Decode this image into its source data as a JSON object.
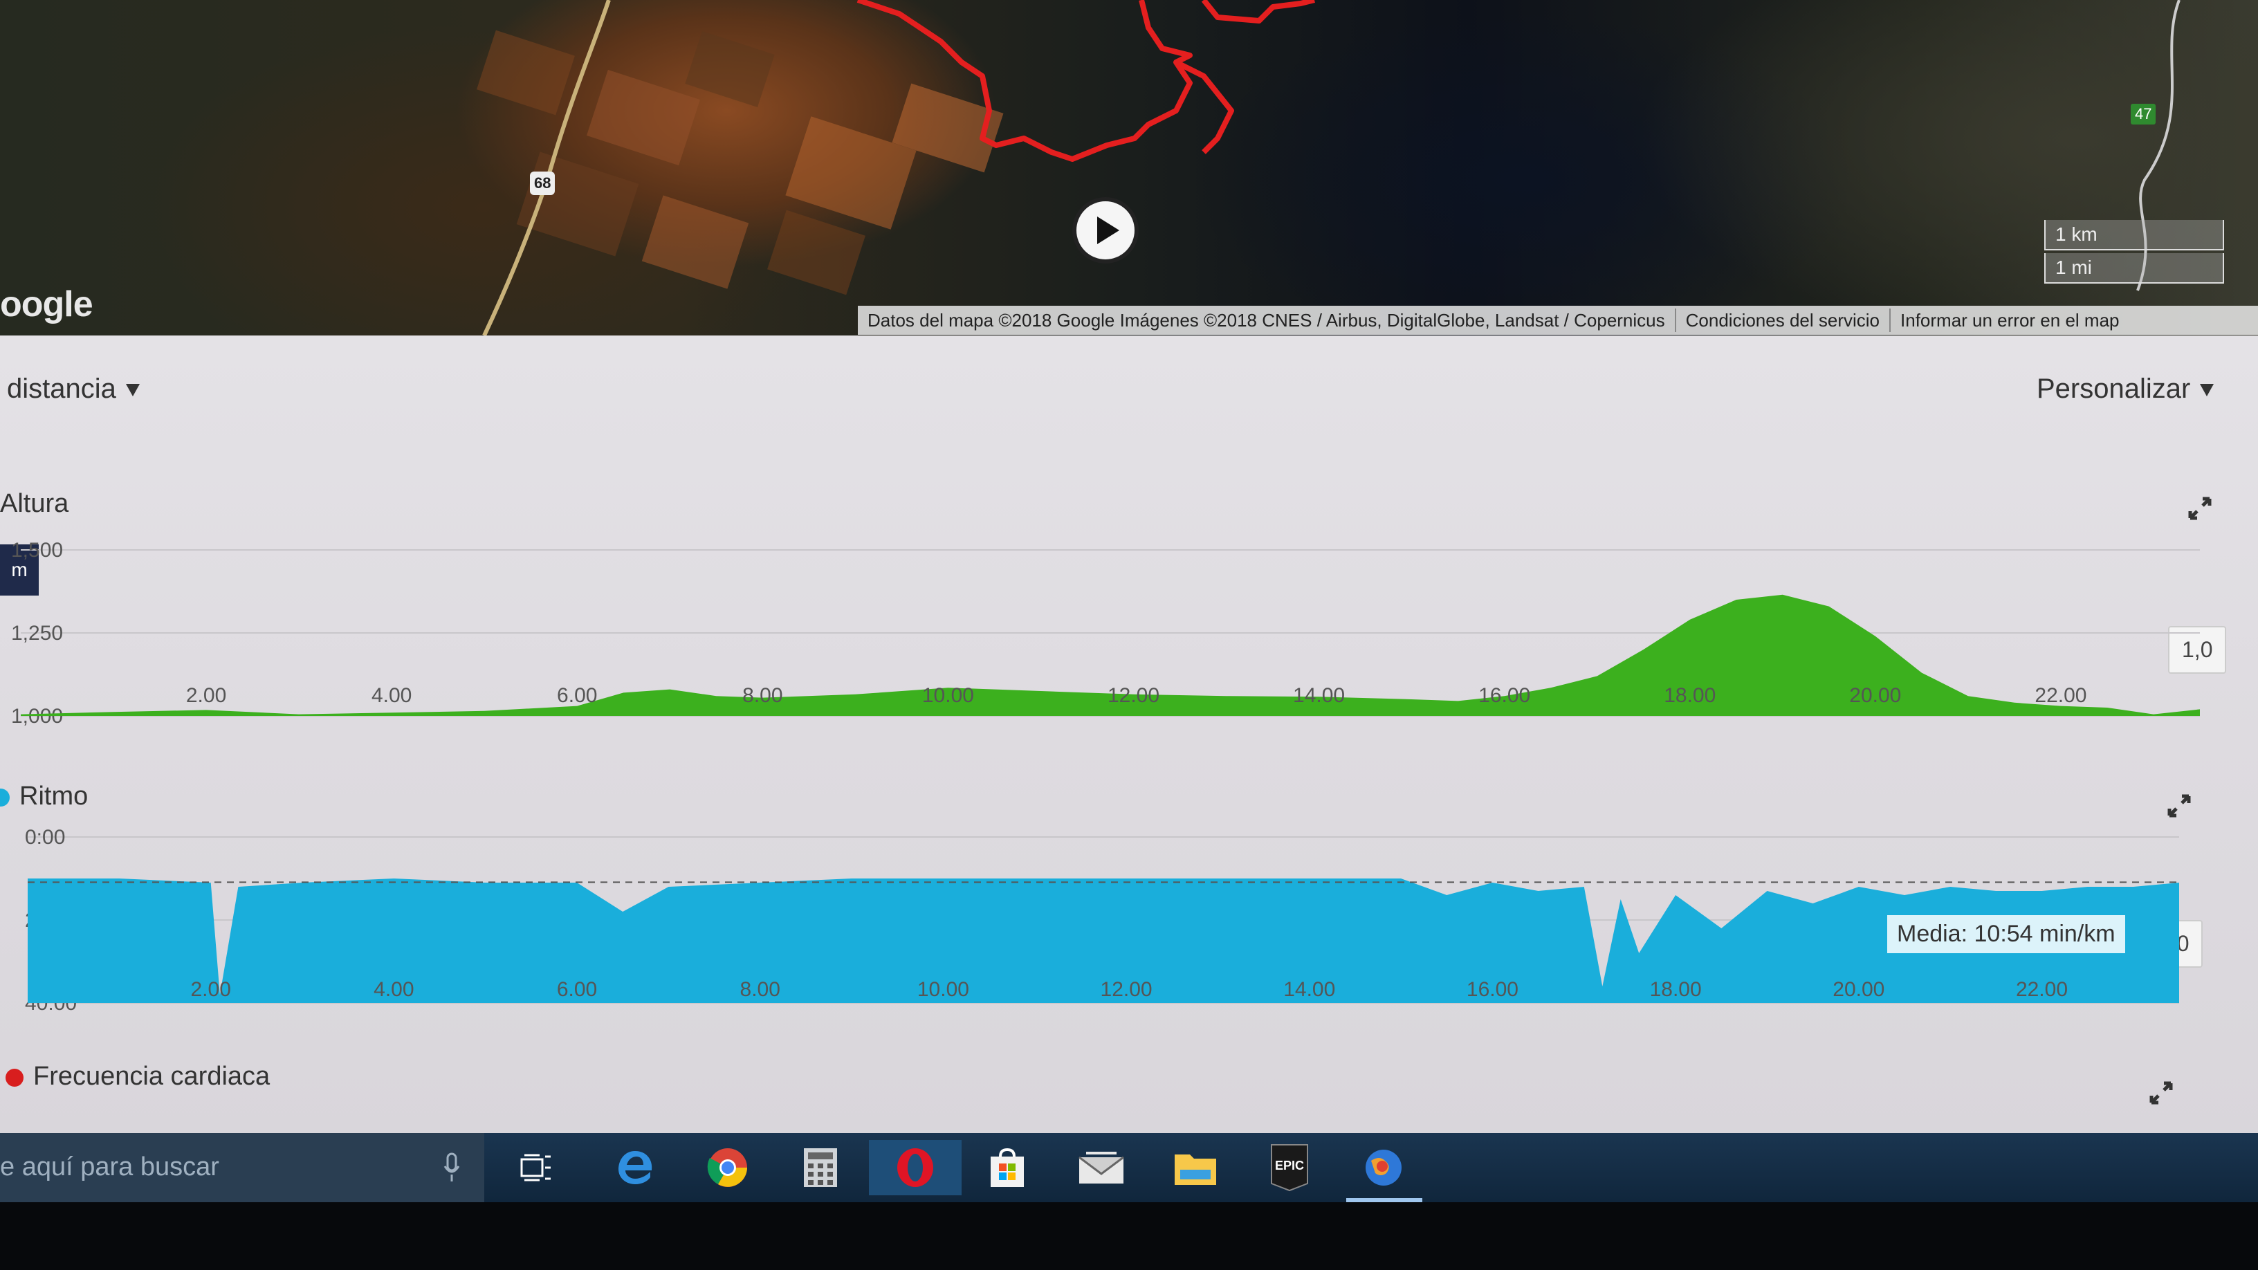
{
  "map": {
    "logo_text": "oogle",
    "attribution": "Datos del mapa ©2018 Google Imágenes ©2018 CNES / Airbus, DigitalGlobe, Landsat / Copernicus",
    "terms_link": "Condiciones del servicio",
    "report_link": "Informar un error en el map",
    "scale_km": "1 km",
    "scale_mi": "1 mi",
    "road_47": "47",
    "road_68": "68",
    "route_color": "#e41f1f"
  },
  "controls": {
    "distance_dropdown": "distancia",
    "customize_dropdown": "Personalizar"
  },
  "elevation": {
    "title": "Altura",
    "unit_badge": "m",
    "y_ticks": [
      "1,500",
      "1,250",
      "1,000"
    ],
    "side_label": "1,0",
    "color": "#3cb01e"
  },
  "pace": {
    "title": "Ritmo",
    "y_ticks": [
      "0:00",
      "20:00",
      "40:00"
    ],
    "average_label": "Media: 10:54 min/km",
    "side_label": "7:0",
    "color": "#1aaedb",
    "dot_color": "#1aaedb"
  },
  "heart_rate": {
    "title": "Frecuencia cardiaca",
    "dot_color": "#d81e1e"
  },
  "taskbar": {
    "search_text": "e aquí para buscar",
    "icons": [
      "task-view-icon",
      "edge-icon",
      "chrome-icon",
      "calculator-icon",
      "opera-icon",
      "store-icon",
      "mail-icon",
      "file-explorer-icon",
      "epic-games-icon",
      "globe-app-icon"
    ],
    "epic_text": "EPIC"
  },
  "chart_data": [
    {
      "type": "area",
      "title": "Altura",
      "xlabel": "",
      "ylabel": "",
      "x_ticks": [
        "2.00",
        "4.00",
        "6.00",
        "8.00",
        "10.00",
        "12.00",
        "14.00",
        "16.00",
        "18.00",
        "20.00",
        "22.00"
      ],
      "ylim": [
        1000,
        1500
      ],
      "y_ticks": [
        1000,
        1250,
        1500
      ],
      "x": [
        0,
        1,
        2,
        3,
        4,
        5,
        6,
        6.5,
        7,
        7.5,
        8,
        9,
        10,
        11,
        12,
        13,
        14,
        15,
        15.5,
        16,
        16.5,
        17,
        17.5,
        18,
        18.5,
        19,
        19.5,
        20,
        20.5,
        21,
        21.5,
        22,
        22.5,
        23,
        23.5
      ],
      "values": [
        1005,
        1012,
        1018,
        1005,
        1010,
        1015,
        1030,
        1070,
        1080,
        1060,
        1055,
        1065,
        1085,
        1075,
        1065,
        1060,
        1058,
        1050,
        1045,
        1060,
        1085,
        1120,
        1200,
        1290,
        1350,
        1365,
        1330,
        1240,
        1130,
        1060,
        1040,
        1030,
        1025,
        1005,
        1020
      ]
    },
    {
      "type": "area",
      "title": "Ritmo",
      "xlabel": "",
      "ylabel": "",
      "x_ticks": [
        "2.00",
        "4.00",
        "6.00",
        "8.00",
        "10.00",
        "12.00",
        "14.00",
        "16.00",
        "18.00",
        "20.00",
        "22.00"
      ],
      "ylim": [
        0,
        40
      ],
      "y_ticks": [
        "0:00",
        "20:00",
        "40:00"
      ],
      "average": "10:54",
      "x": [
        0,
        1,
        2,
        2.1,
        2.3,
        3,
        4,
        5,
        6,
        6.5,
        7,
        8,
        9,
        10,
        11,
        12,
        13,
        14,
        15,
        15.5,
        16,
        16.5,
        17,
        17.2,
        17.4,
        17.6,
        18,
        18.5,
        19,
        19.5,
        20,
        20.5,
        21,
        21.5,
        22,
        22.5,
        23,
        23.5
      ],
      "values": [
        10,
        10,
        11,
        38,
        12,
        11,
        10,
        11,
        11,
        18,
        12,
        11,
        10,
        10,
        10,
        10,
        10,
        10,
        10,
        14,
        11,
        13,
        12,
        36,
        15,
        28,
        14,
        22,
        13,
        16,
        12,
        14,
        12,
        13,
        13,
        12,
        12,
        11
      ]
    }
  ]
}
